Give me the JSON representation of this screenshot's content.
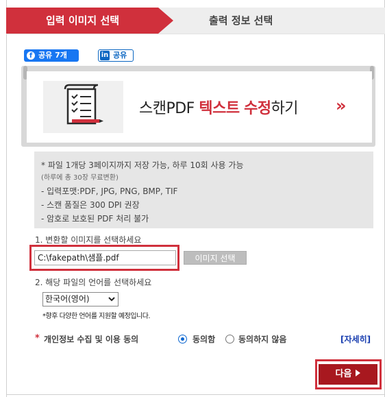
{
  "steps": {
    "active": "입력 이미지 선택",
    "next": "출력 정보 선택"
  },
  "share": {
    "facebook_label": "공유 7개",
    "facebook_icon": "f",
    "linkedin_label": "공유",
    "linkedin_icon": "in"
  },
  "banner": {
    "text_prefix": "스캔PDF ",
    "text_highlight_1": "텍스트",
    "text_space": " ",
    "text_highlight_2": "수정",
    "text_suffix": "하기",
    "chevron": "»",
    "icon": "document-edit-icon"
  },
  "info": {
    "lines": [
      "* 파일 1개당 3페이지까지 저장 가능, 하루 10회 사용 가능",
      "(하루에 총 30장 무료변환)",
      "- 입력포맷:PDF, JPG, PNG, BMP, TIF",
      "- 스캔 품질은 300 DPI 권장",
      "- 암호로 보호된 PDF 처리 불가"
    ]
  },
  "section1": {
    "label": "1. 변환할 이미지를 선택하세요",
    "file_value": "C:\\fakepath\\샘플.pdf",
    "button": "이미지 선택"
  },
  "section2": {
    "label": "2. 해당 파일의 언어를 선택하세요",
    "selected_language": "한국어(영어)",
    "note": "*향후 다양한 언어를 지원할 예정입니다."
  },
  "consent": {
    "star": "*",
    "label": "개인정보 수집 및 이용 동의",
    "agree": "동의함",
    "disagree": "동의하지 않음",
    "selected": "agree",
    "detail": "[자세히]"
  },
  "next_button": "다음",
  "colors": {
    "accent": "#d0303c",
    "next_button": "#a8181f",
    "facebook": "#1877f2",
    "linkedin": "#0a66c2"
  }
}
